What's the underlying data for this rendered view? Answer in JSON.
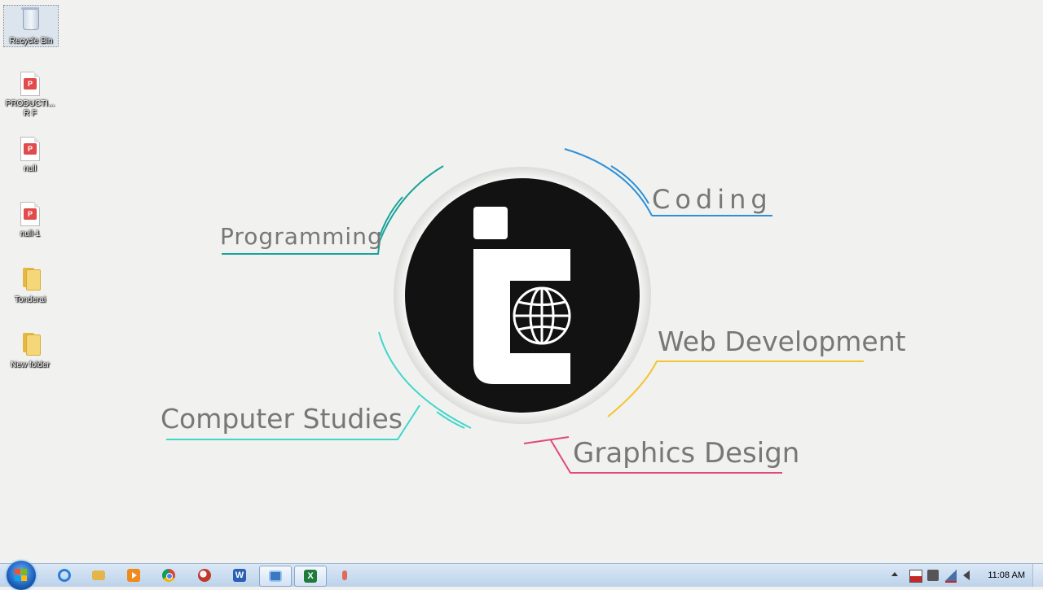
{
  "desktop": {
    "icons": [
      {
        "label": "Recycle Bin",
        "type": "recycle-bin"
      },
      {
        "label": "PRODUCTI...\nR F",
        "type": "pdf"
      },
      {
        "label": "null",
        "type": "pdf"
      },
      {
        "label": "null-1",
        "type": "pdf"
      },
      {
        "label": "Tonderai",
        "type": "folder"
      },
      {
        "label": "New folder",
        "type": "folder"
      }
    ]
  },
  "logo": {
    "topics": {
      "programming": "Programming",
      "coding": "Coding",
      "web": "Web Development",
      "computer": "Computer Studies",
      "graphics": "Graphics Design"
    },
    "colors": {
      "programming": "#1aa39a",
      "coding": "#2f8fd8",
      "web": "#f2c531",
      "computer": "#3fd6cc",
      "graphics": "#e0497a",
      "circle": "#121212",
      "label_text": "#777777"
    }
  },
  "taskbar": {
    "start_icon": "windows-start-orb",
    "pinned": [
      {
        "name": "internet-explorer-icon",
        "color": "#2b7fd6"
      },
      {
        "name": "file-explorer-icon",
        "color": "#e3b54a"
      },
      {
        "name": "media-player-icon",
        "color": "#f08a1c"
      },
      {
        "name": "chrome-icon",
        "color": "#db4437"
      },
      {
        "name": "paint-icon",
        "color": "#c0392b"
      },
      {
        "name": "word-icon",
        "color": "#2b5fb5"
      },
      {
        "name": "remote-desktop-icon",
        "color": "#3a78c2"
      },
      {
        "name": "excel-icon",
        "color": "#1e7b3c"
      },
      {
        "name": "microphone-icon",
        "color": "#e06a5a"
      }
    ],
    "tray_icons": [
      "show-hidden-icons",
      "action-center-flag-icon",
      "printer-icon",
      "network-icon",
      "volume-icon"
    ],
    "clock": "11:08 AM"
  }
}
